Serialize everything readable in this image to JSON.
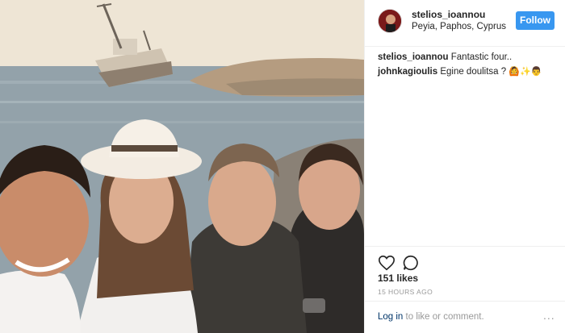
{
  "post": {
    "username": "stelios_ioannou",
    "location": "Peyia, Paphos, Cyprus",
    "follow_label": "Follow",
    "icons": {
      "like": "heart-icon",
      "comment": "comment-bubble-icon",
      "more": "more-options-icon"
    },
    "comments": [
      {
        "user": "stelios_ioannou",
        "text": "Fantastic four..",
        "emoji": ""
      },
      {
        "user": "johnkagioulis",
        "text": "Egine doulitsa ?",
        "emoji": "🙆✨👨"
      }
    ],
    "likes": "151 likes",
    "timestamp": "15 HOURS AGO",
    "login_link": "Log in",
    "login_suffix": " to like or comment.",
    "more_dots": "..."
  },
  "colors": {
    "follow_button": "#3897f0",
    "link": "#003569",
    "muted": "#999999"
  }
}
